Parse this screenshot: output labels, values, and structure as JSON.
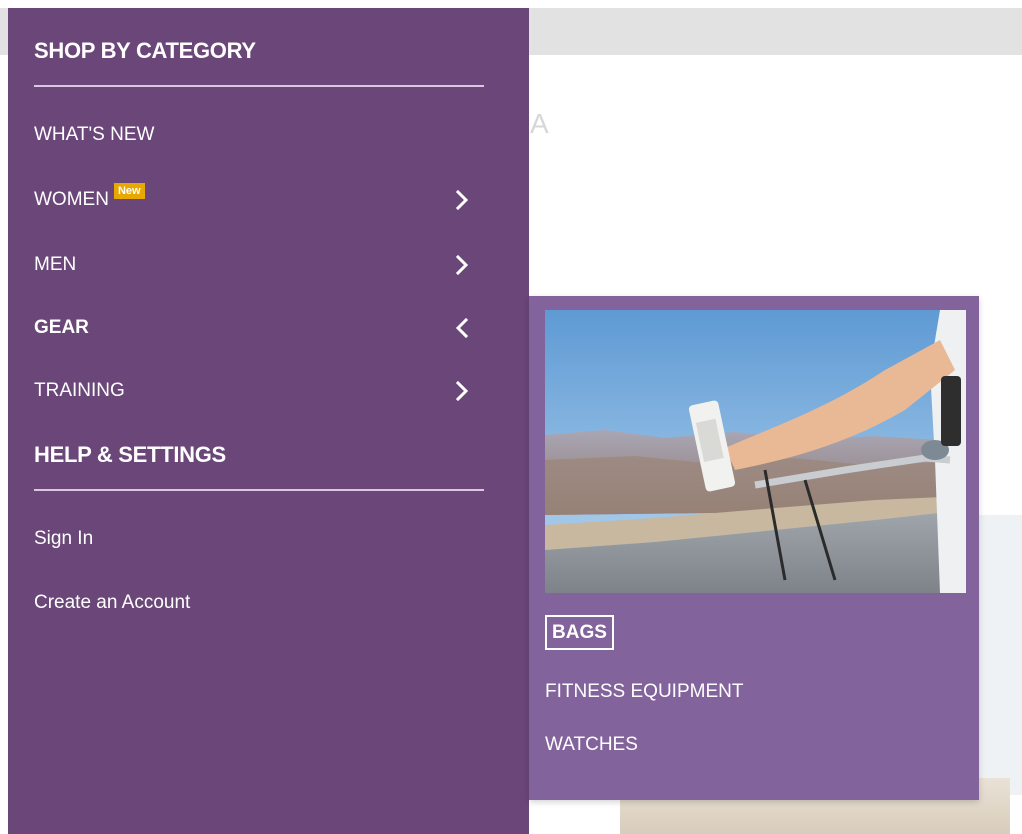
{
  "page_behind": {
    "partial_letter": "A"
  },
  "drawer": {
    "category_heading": "SHOP BY CATEGORY",
    "categories": [
      {
        "label": "WHAT'S NEW",
        "has_children": false,
        "badge": ""
      },
      {
        "label": "WOMEN",
        "has_children": true,
        "badge": "New"
      },
      {
        "label": "MEN",
        "has_children": true,
        "badge": ""
      },
      {
        "label": "GEAR",
        "has_children": true,
        "badge": "",
        "expanded": true
      },
      {
        "label": "TRAINING",
        "has_children": true,
        "badge": ""
      }
    ],
    "help_heading": "HELP & SETTINGS",
    "account_links": [
      {
        "label": "Sign In"
      },
      {
        "label": "Create an Account"
      }
    ]
  },
  "gear_submenu": {
    "items": [
      {
        "label": "BAGS",
        "focused": true
      },
      {
        "label": "FITNESS EQUIPMENT",
        "focused": false
      },
      {
        "label": "WATCHES",
        "focused": false
      }
    ]
  },
  "colors": {
    "drawer_bg": "#6b4679",
    "submenu_bg": "#83639b",
    "badge_bg": "#e8a800",
    "divider": "#d9c8df"
  },
  "icons": {
    "chevron_right": "chevron-right-icon",
    "chevron_left": "chevron-left-icon"
  }
}
